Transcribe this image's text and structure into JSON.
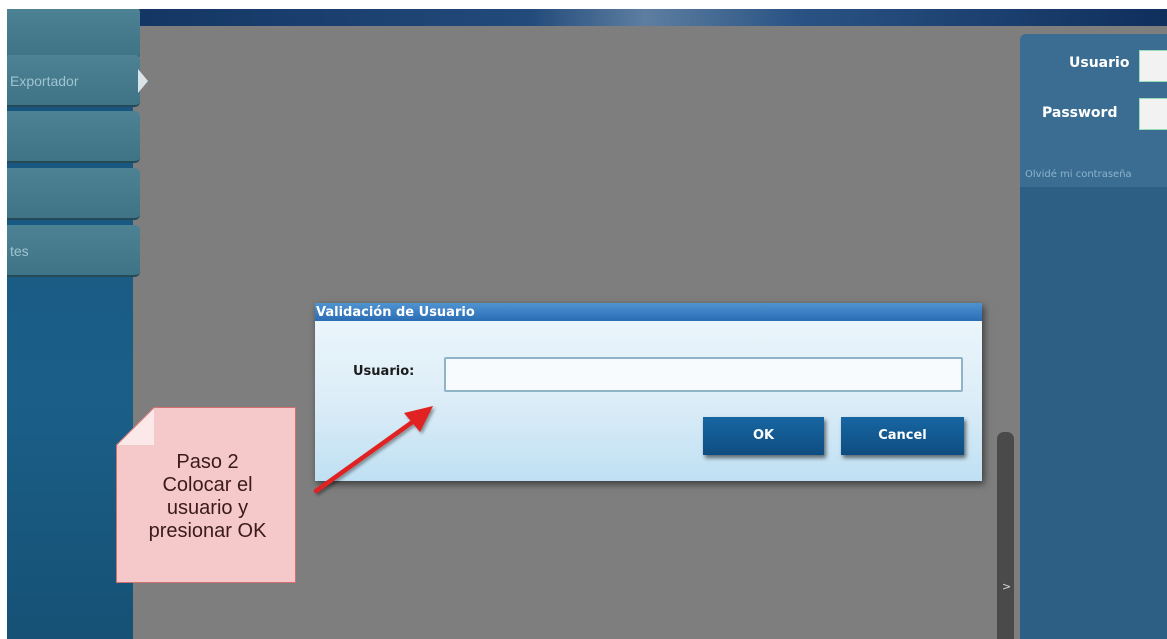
{
  "sidebar": {
    "items": [
      {
        "label": ""
      },
      {
        "label": "Exportador"
      },
      {
        "label": ""
      },
      {
        "label": ""
      },
      {
        "label": "tes"
      }
    ]
  },
  "login_panel": {
    "user_label": "Usuario",
    "password_label": "Password",
    "forgot_link": "Olvidé mi contraseña"
  },
  "scroll_toggle": {
    "glyph": ">"
  },
  "dialog": {
    "title": "Validación de Usuario",
    "field_label": "Usuario:",
    "field_value": "",
    "ok_label": "OK",
    "cancel_label": "Cancel"
  },
  "callout": {
    "lines": [
      "Paso 2",
      "Colocar el",
      "usuario y",
      "presionar OK"
    ]
  },
  "colors": {
    "overlay": "#7e7e7e",
    "dialog_title": "#2a6db4",
    "button": "#1766a3",
    "note_fill": "#f5c9c9",
    "arrow": "#e02020"
  }
}
